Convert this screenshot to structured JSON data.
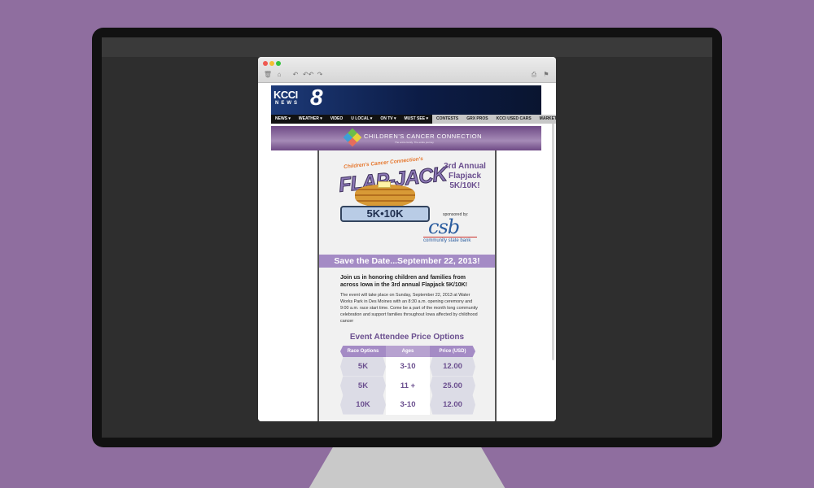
{
  "email": {
    "kcci": {
      "logo": "KCCI",
      "news": "NEWS",
      "channel": "8",
      "nav_left": [
        "NEWS ▾",
        "WEATHER ▾",
        "VIDEO",
        "U LOCAL ▾",
        "ON TV ▾",
        "MUST SEE ▾"
      ],
      "nav_right": [
        "CONTESTS",
        "GRX PROS",
        "KCCI USED CARS",
        "MARKETPLACE ▾"
      ]
    },
    "banner": {
      "title": "CHILDREN'S CANCER CONNECTION",
      "subtitle": "The entire family. The entire journey."
    },
    "logo": {
      "arc": "Children's Cancer Connection's",
      "word": "FLAP-JACK",
      "ribbon": "5K•10K"
    },
    "event_title": "3rd Annual Flapjack 5K/10K!",
    "sponsor": {
      "label": "sponsored by:",
      "name": "csb",
      "full": "community state bank"
    },
    "save_date": "Save the Date...September 22, 2013!",
    "intro": "Join us in honoring children and families from across Iowa in the 3rd annual Flapjack 5K/10K!",
    "body": "The event will take place on Sunday, September 22, 2013 at Water Works Park in Des Moines with an 8:30 a.m. opening ceremony and 9:00 a.m. race start time. Come be a part of the month long community celebration and support families throughout Iowa affected by childhood cancer",
    "price_title": "Event Attendee Price Options",
    "price_table": {
      "headers": [
        "Race Options",
        "Ages",
        "Price (USD)"
      ],
      "rows": [
        [
          "5K",
          "3-10",
          "12.00"
        ],
        [
          "5K",
          "11 +",
          "25.00"
        ],
        [
          "10K",
          "3-10",
          "12.00"
        ]
      ]
    }
  },
  "icons": {
    "toolbar": [
      "trash-icon",
      "archive-icon",
      "reply-icon",
      "reply-all-icon",
      "forward-icon",
      "print-icon",
      "flag-icon"
    ],
    "glyphs": [
      "🗑",
      "⌂",
      "↶",
      "↶↶",
      "↷",
      "⎙",
      "⚑"
    ]
  },
  "colors": {
    "background": "#8f6e9f",
    "accent_purple": "#a48bc5",
    "title_purple": "#6b4f8f"
  }
}
